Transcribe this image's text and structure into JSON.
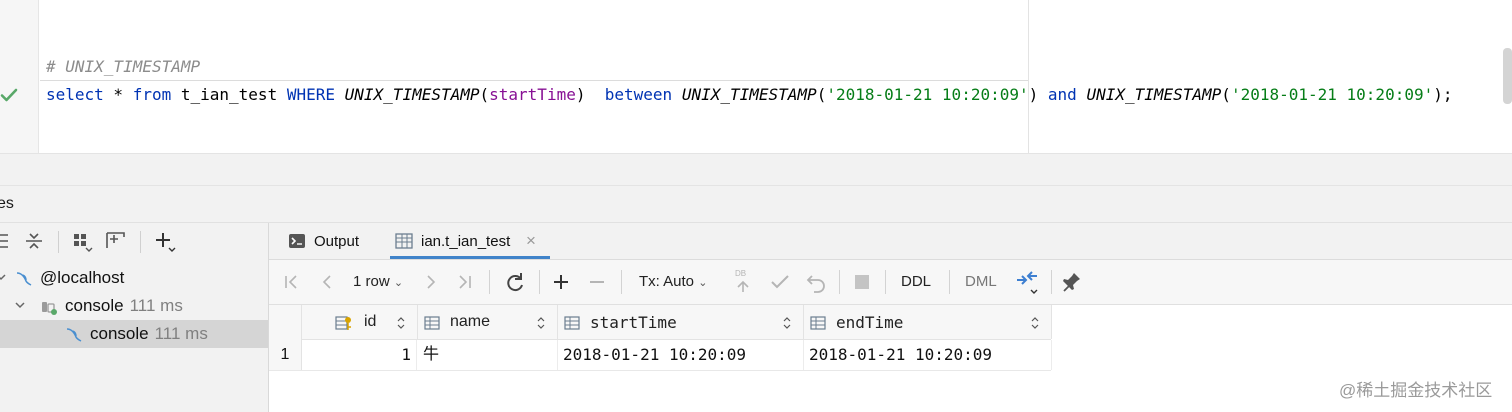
{
  "editor": {
    "comment_line": "# UNIX_TIMESTAMP",
    "sql": {
      "t1": "select",
      "t2": " * ",
      "t3": "from",
      "t4": " t_ian_test ",
      "t5": "WHERE",
      "t6": " ",
      "t7": "UNIX_TIMESTAMP",
      "t8": "(",
      "t9": "startTime",
      "t10": ")  ",
      "t11": "between",
      "t12": " ",
      "t13": "UNIX_TIMESTAMP",
      "t14": "(",
      "t15": "'2018-01-21 10:20:09'",
      "t16": ") ",
      "t17": "and",
      "t18": " ",
      "t19": "UNIX_TIMESTAMP",
      "t20": "(",
      "t21": "'2018-01-21 10:20:09'",
      "t22": ");"
    },
    "status_icon": "check-icon"
  },
  "services": {
    "title": "es"
  },
  "tree": {
    "host": "@localhost",
    "console_parent": {
      "label": "console",
      "time": "111 ms"
    },
    "console_child": {
      "label": "console",
      "time": "111 ms"
    }
  },
  "tabs": {
    "output": "Output",
    "table": "ian.t_ian_test",
    "close": "×"
  },
  "toolbar": {
    "rows": "1 row",
    "tx": "Tx: Auto",
    "ddl": "DDL",
    "dml": "DML",
    "db_badge": "DB"
  },
  "grid": {
    "headers": [
      "id",
      "name",
      "startTime",
      "endTime"
    ],
    "rows": [
      {
        "num": "1",
        "id": "1",
        "name": "牛",
        "startTime": "2018-01-21 10:20:09",
        "endTime": "2018-01-21 10:20:09"
      }
    ]
  },
  "watermark": "@稀土掘金技术社区",
  "colors": {
    "keyword": "#0033b3",
    "string": "#067d17",
    "column": "#871094",
    "comment": "#8c8c8c",
    "tab_underline": "#4083c9",
    "ok_green": "#59a869"
  }
}
